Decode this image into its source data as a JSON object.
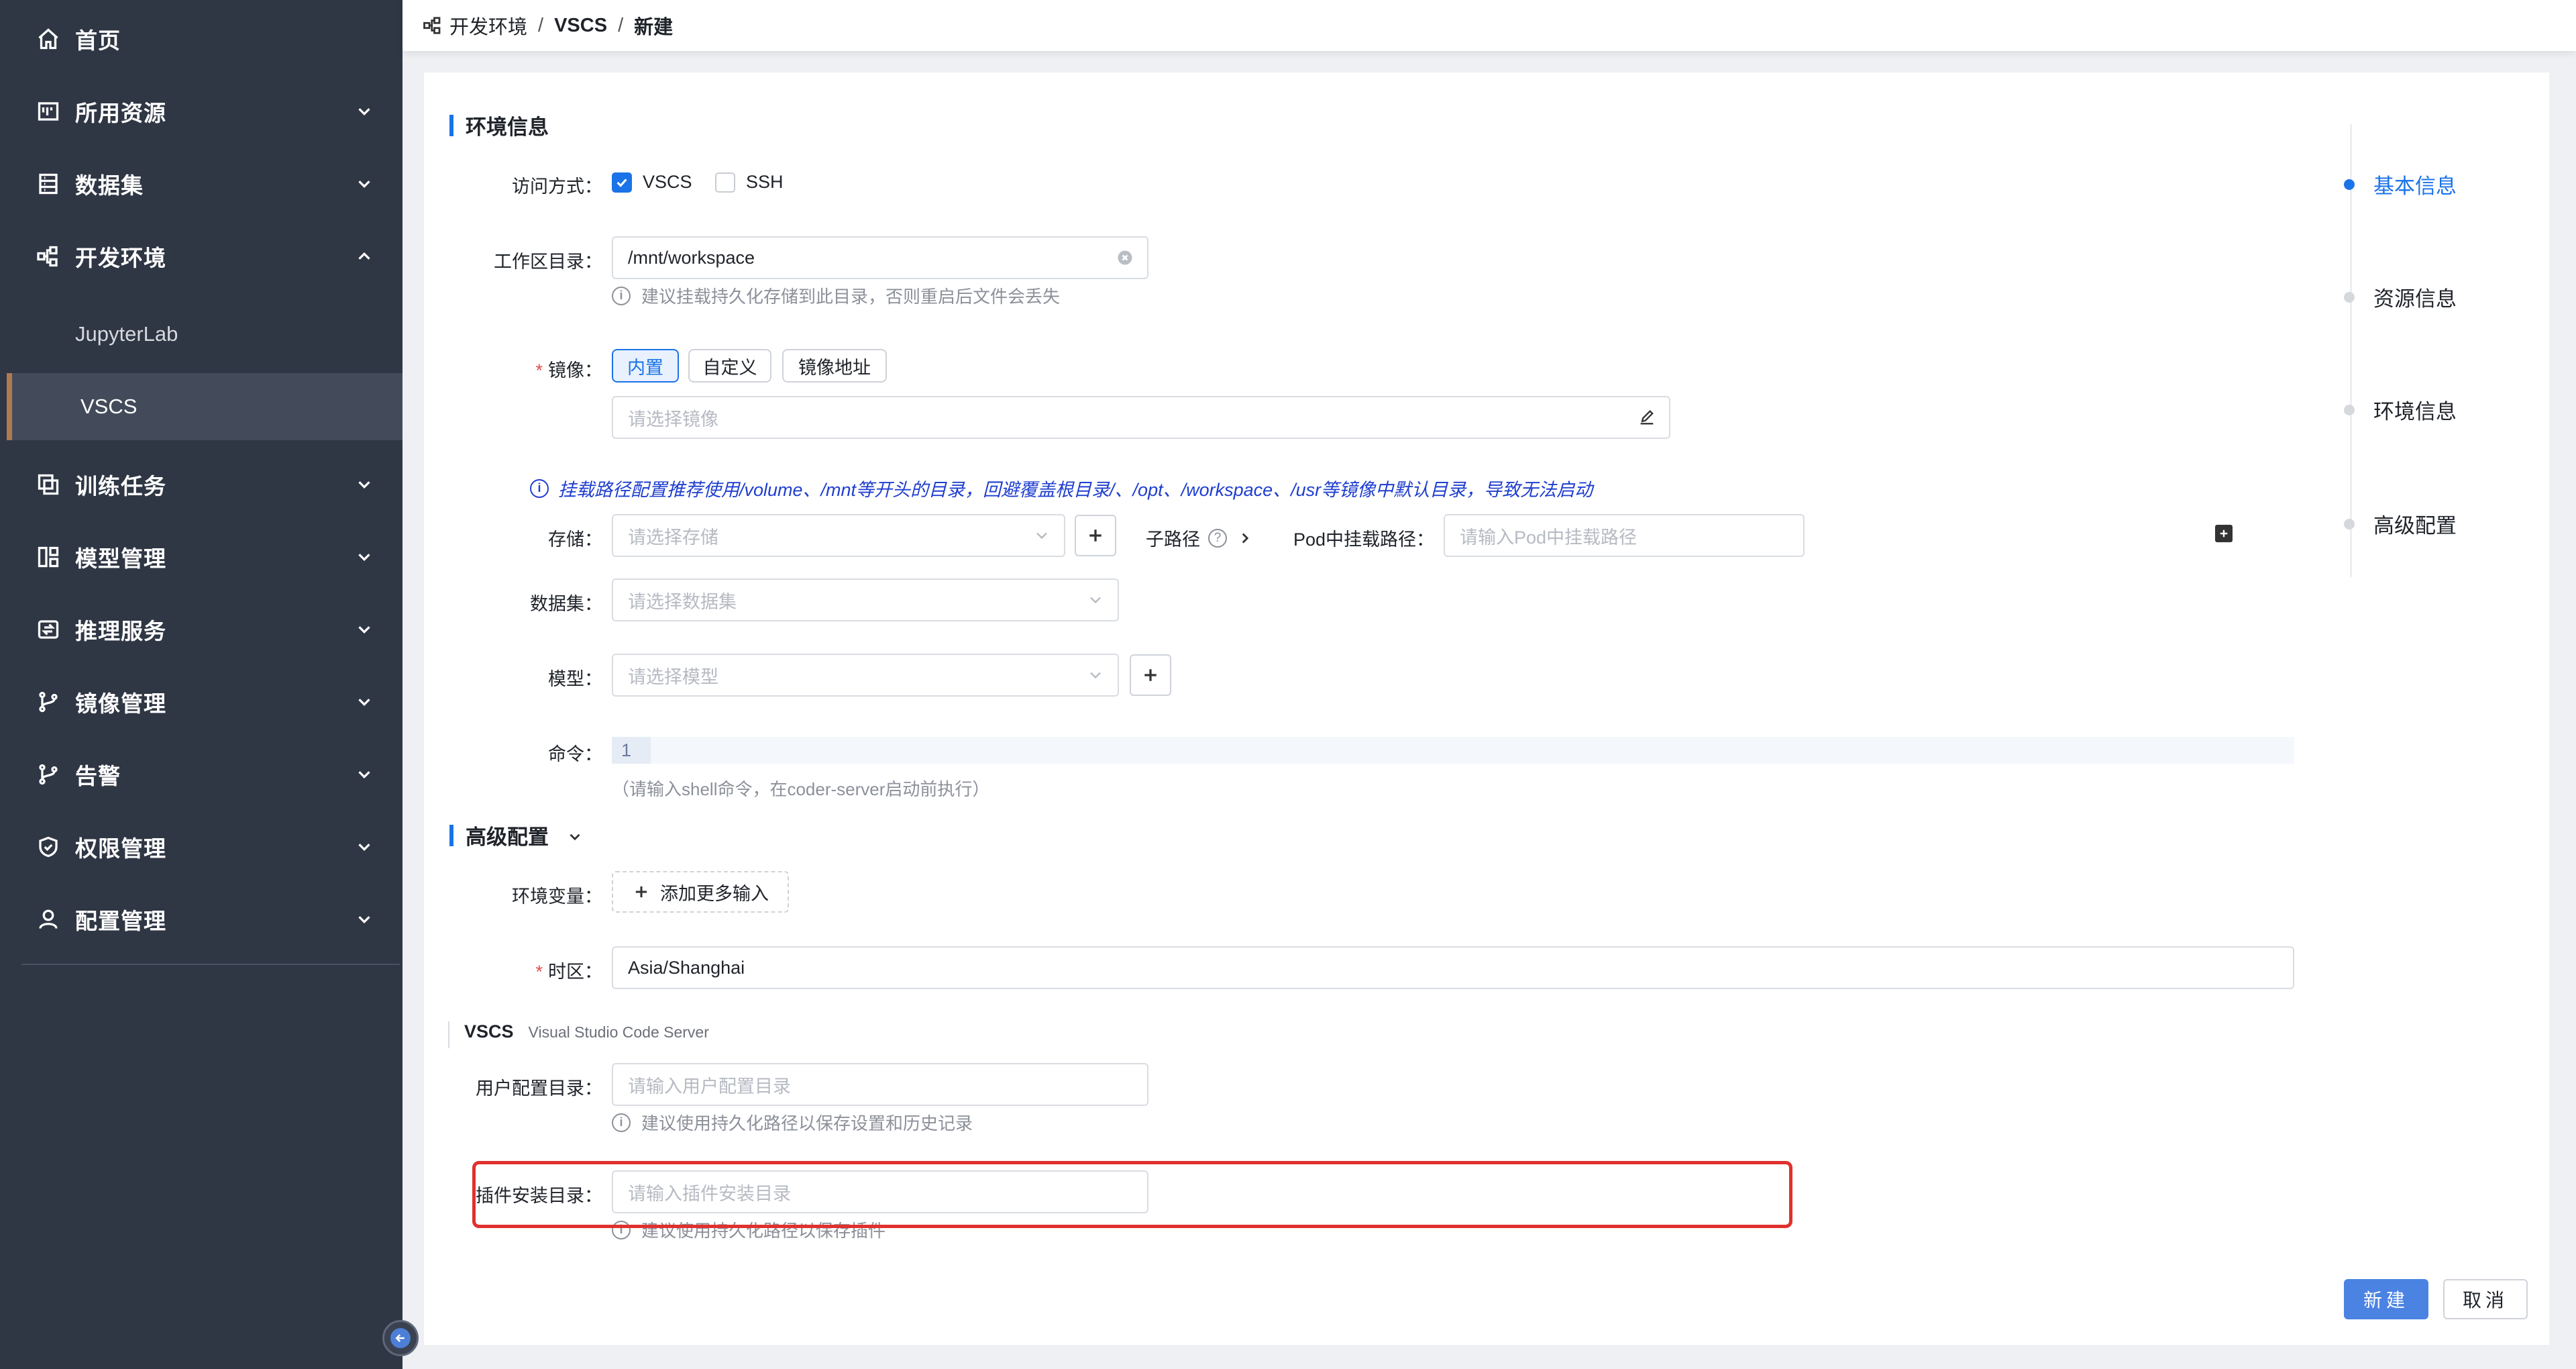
{
  "sidebar": {
    "items": [
      {
        "label": "首页",
        "icon": "home-icon",
        "expandable": false
      },
      {
        "label": "所用资源",
        "icon": "resource-icon",
        "expandable": true
      },
      {
        "label": "数据集",
        "icon": "dataset-icon",
        "expandable": true
      },
      {
        "label": "开发环境",
        "icon": "dev-env-icon",
        "expandable": true,
        "expanded": true
      },
      {
        "label": "训练任务",
        "icon": "training-icon",
        "expandable": true
      },
      {
        "label": "模型管理",
        "icon": "model-icon",
        "expandable": true
      },
      {
        "label": "推理服务",
        "icon": "inference-icon",
        "expandable": true
      },
      {
        "label": "镜像管理",
        "icon": "branch-icon",
        "expandable": true
      },
      {
        "label": "告警",
        "icon": "alert-icon",
        "expandable": true
      },
      {
        "label": "权限管理",
        "icon": "shield-icon",
        "expandable": true
      },
      {
        "label": "配置管理",
        "icon": "user-icon",
        "expandable": true
      }
    ],
    "sub_items": [
      {
        "label": "JupyterLab",
        "active": false
      },
      {
        "label": "VSCS",
        "active": true
      }
    ]
  },
  "breadcrumb": {
    "items": [
      "开发环境",
      "VSCS",
      "新建"
    ],
    "separator": "/"
  },
  "form": {
    "env_section_title": "环境信息",
    "access": {
      "label": "访问方式：",
      "options": [
        {
          "label": "VSCS",
          "checked": true
        },
        {
          "label": "SSH",
          "checked": false
        }
      ]
    },
    "workspace": {
      "label": "工作区目录：",
      "value": "/mnt/workspace",
      "hint": "建议挂载持久化存储到此目录，否则重启后文件会丢失"
    },
    "image": {
      "required_mark": "*",
      "label": "镜像：",
      "tabs": [
        "内置",
        "自定义",
        "镜像地址"
      ],
      "active_tab": "内置",
      "placeholder": "请选择镜像"
    },
    "mount_notice": "挂载路径配置推荐使用/volume、/mnt等开头的目录，回避覆盖根目录/、/opt、/workspace、/usr等镜像中默认目录，导致无法启动",
    "storage": {
      "label": "存储：",
      "placeholder": "请选择存储",
      "subpath_label": "子路径",
      "pod_mount_label": "Pod中挂载路径：",
      "pod_mount_placeholder": "请输入Pod中挂载路径"
    },
    "dataset": {
      "label": "数据集：",
      "placeholder": "请选择数据集"
    },
    "model": {
      "label": "模型：",
      "placeholder": "请选择模型"
    },
    "command": {
      "label": "命令：",
      "line_number": "1",
      "hint": "（请输入shell命令，在coder-server启动前执行）"
    },
    "advanced_section_title": "高级配置",
    "env_vars": {
      "label": "环境变量：",
      "add_label": "添加更多输入"
    },
    "timezone": {
      "required_mark": "*",
      "label": "时区：",
      "value": "Asia/Shanghai"
    },
    "vscs_section": {
      "title": "VSCS",
      "subtitle": "Visual Studio Code Server"
    },
    "user_config": {
      "label": "用户配置目录：",
      "placeholder": "请输入用户配置目录",
      "hint": "建议使用持久化路径以保存设置和历史记录"
    },
    "plugin_dir": {
      "label": "插件安装目录：",
      "placeholder": "请输入插件安装目录",
      "hint": "建议使用持久化路径以保存插件"
    }
  },
  "anchors": [
    {
      "label": "基本信息",
      "active": true
    },
    {
      "label": "资源信息",
      "active": false
    },
    {
      "label": "环境信息",
      "active": false
    },
    {
      "label": "高级配置",
      "active": false
    }
  ],
  "actions": {
    "create_label": "新建",
    "cancel_label": "取消"
  },
  "colors": {
    "sidebar_bg": "#2f3644",
    "accent": "#1a73e8",
    "highlight": "#e0312e",
    "notice": "#1f3ecf"
  }
}
